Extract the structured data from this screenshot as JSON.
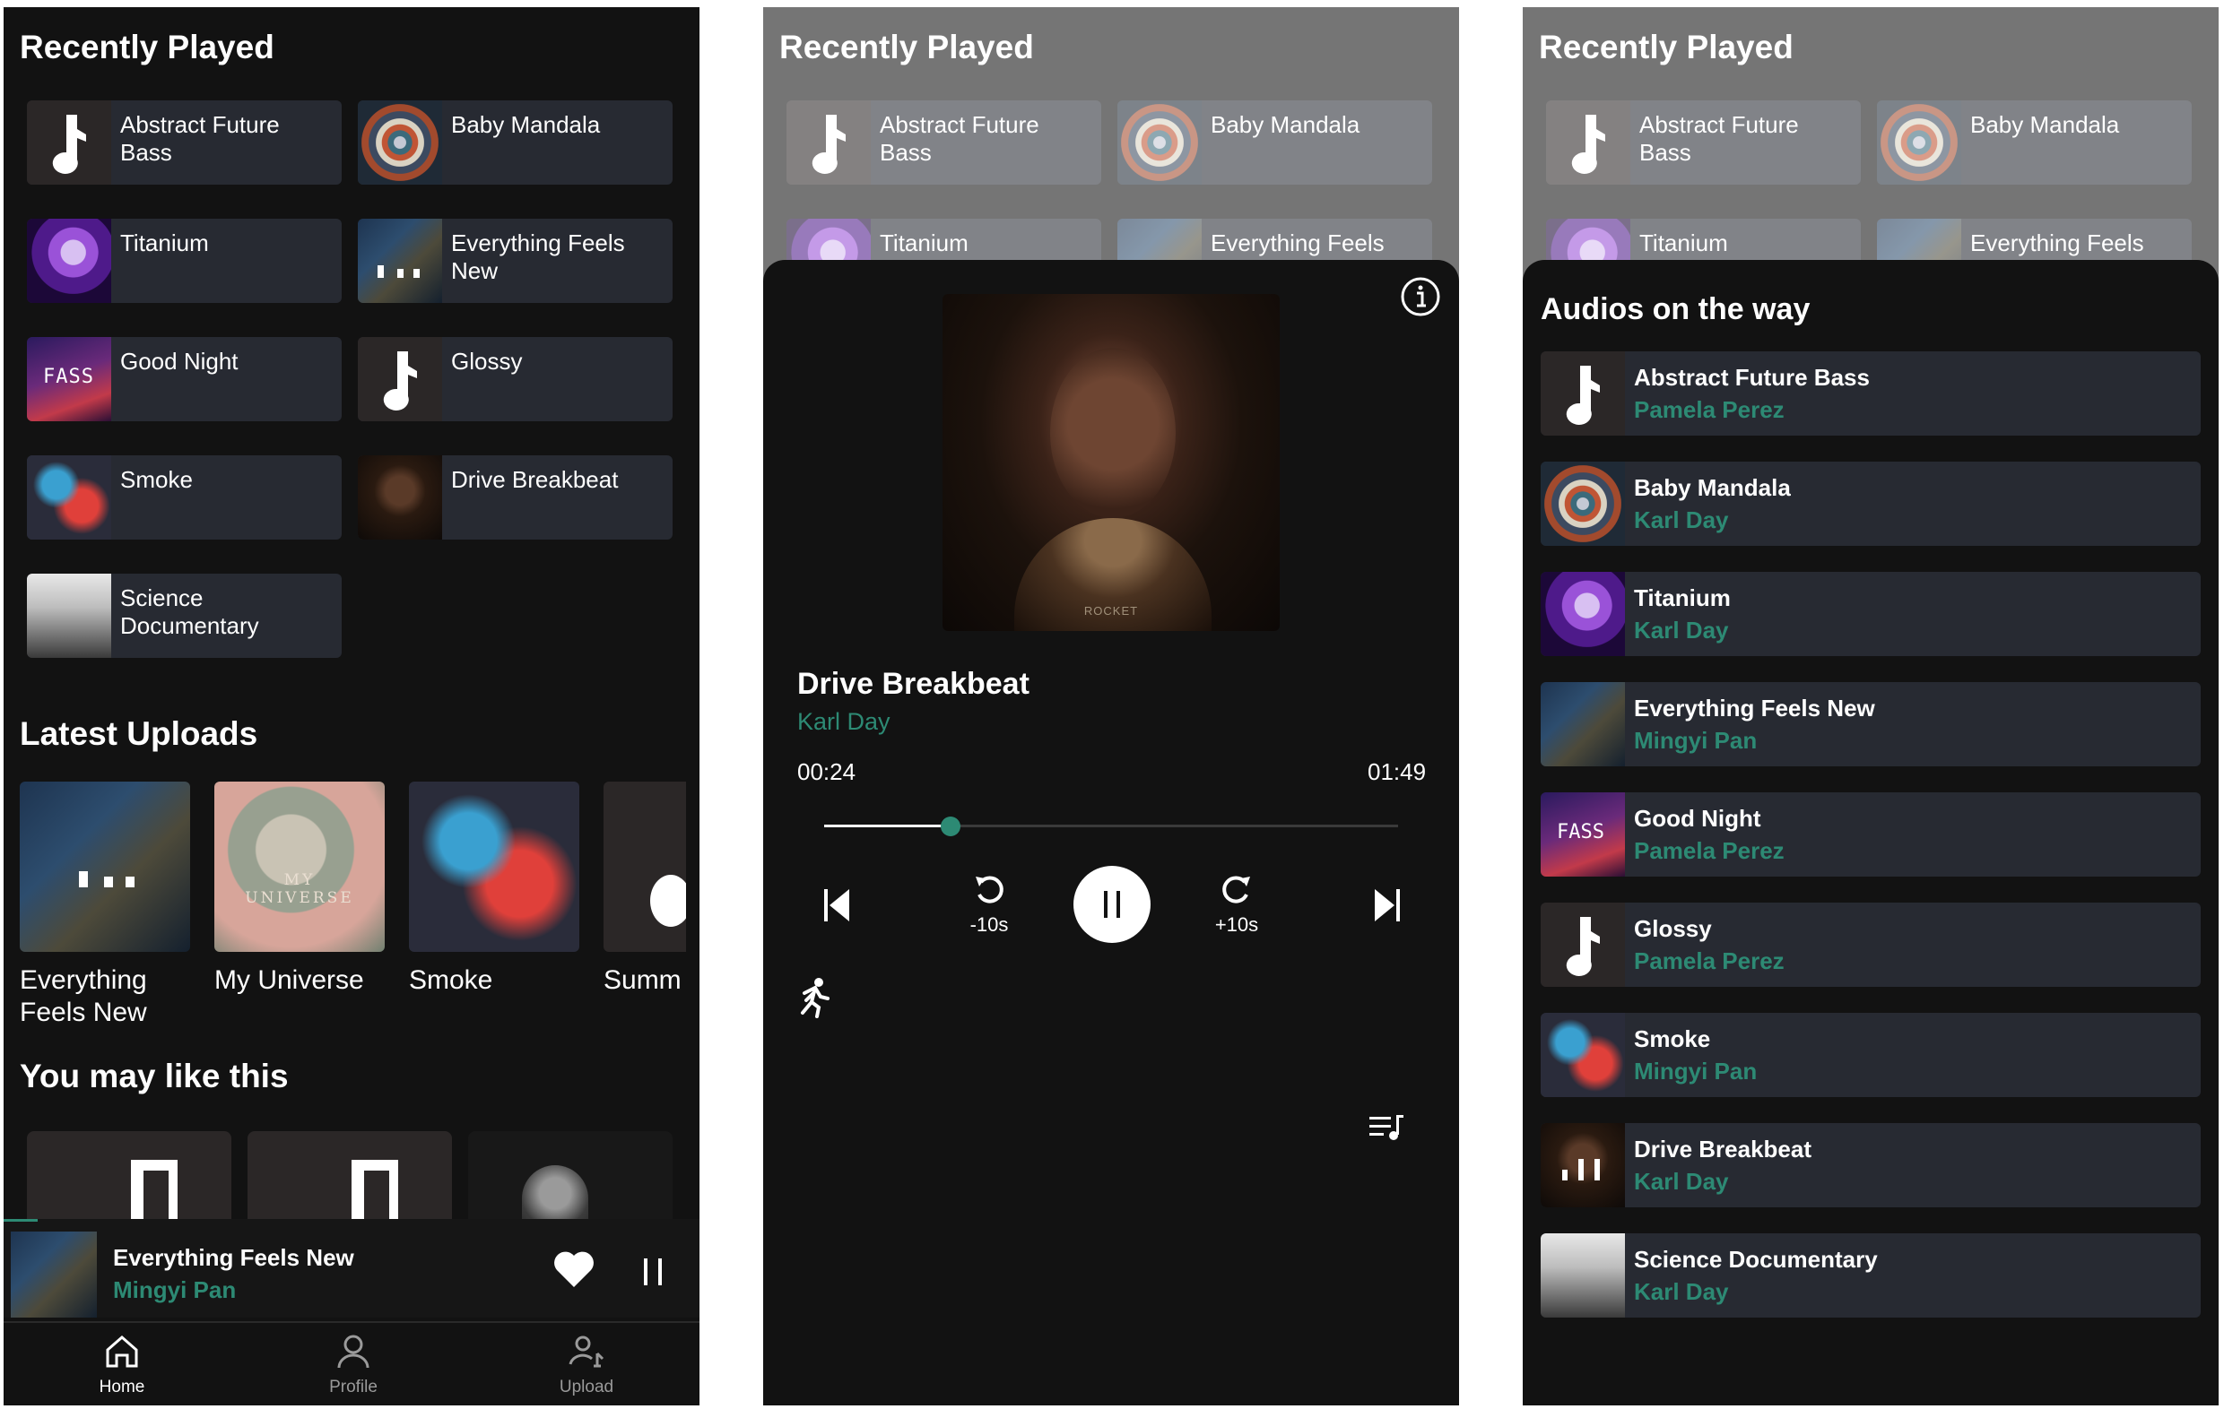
{
  "recently_played": {
    "title": "Recently Played",
    "items": [
      {
        "label": "Abstract Future Bass",
        "art": "music-note"
      },
      {
        "label": "Baby Mandala",
        "art": "mandala"
      },
      {
        "label": "Titanium",
        "art": "titanium"
      },
      {
        "label": "Everything Feels New",
        "art": "everything"
      },
      {
        "label": "Good Night",
        "art": "goodnight"
      },
      {
        "label": "Glossy",
        "art": "music-note"
      },
      {
        "label": "Smoke",
        "art": "smoke"
      },
      {
        "label": "Drive Breakbeat",
        "art": "drive"
      },
      {
        "label": "Science Documentary",
        "art": "science"
      }
    ]
  },
  "latest_uploads": {
    "title": "Latest Uploads",
    "items": [
      {
        "label": "Everything Feels New"
      },
      {
        "label": "My Universe"
      },
      {
        "label": "Smoke"
      },
      {
        "label": "Summ"
      }
    ]
  },
  "my_universe_art_text": "MY UNIVERSE",
  "you_may_like": {
    "title": "You may like this"
  },
  "mini_player": {
    "title": "Everything Feels New",
    "artist": "Mingyi Pan"
  },
  "nav": {
    "home": "Home",
    "profile": "Profile",
    "upload": "Upload"
  },
  "now_playing": {
    "title": "Drive Breakbeat",
    "artist": "Karl Day",
    "elapsed": "00:24",
    "duration": "01:49",
    "progress": 0.22,
    "rewind_label": "-10s",
    "forward_label": "+10s",
    "album_text": "ROCKET"
  },
  "queue": {
    "title": "Audios on the way",
    "items": [
      {
        "title": "Abstract Future Bass",
        "artist": "Pamela Perez"
      },
      {
        "title": "Baby Mandala",
        "artist": "Karl Day"
      },
      {
        "title": "Titanium",
        "artist": "Karl Day"
      },
      {
        "title": "Everything Feels New",
        "artist": "Mingyi Pan"
      },
      {
        "title": "Good Night",
        "artist": "Pamela Perez"
      },
      {
        "title": "Glossy",
        "artist": "Pamela Perez"
      },
      {
        "title": "Smoke",
        "artist": "Mingyi Pan"
      },
      {
        "title": "Drive Breakbeat",
        "artist": "Karl Day"
      },
      {
        "title": "Science Documentary",
        "artist": "Karl Day"
      }
    ]
  },
  "fass_logo": "FASS",
  "colors": {
    "accent": "#2d8a74",
    "card": "#272a32",
    "background": "#121212"
  }
}
